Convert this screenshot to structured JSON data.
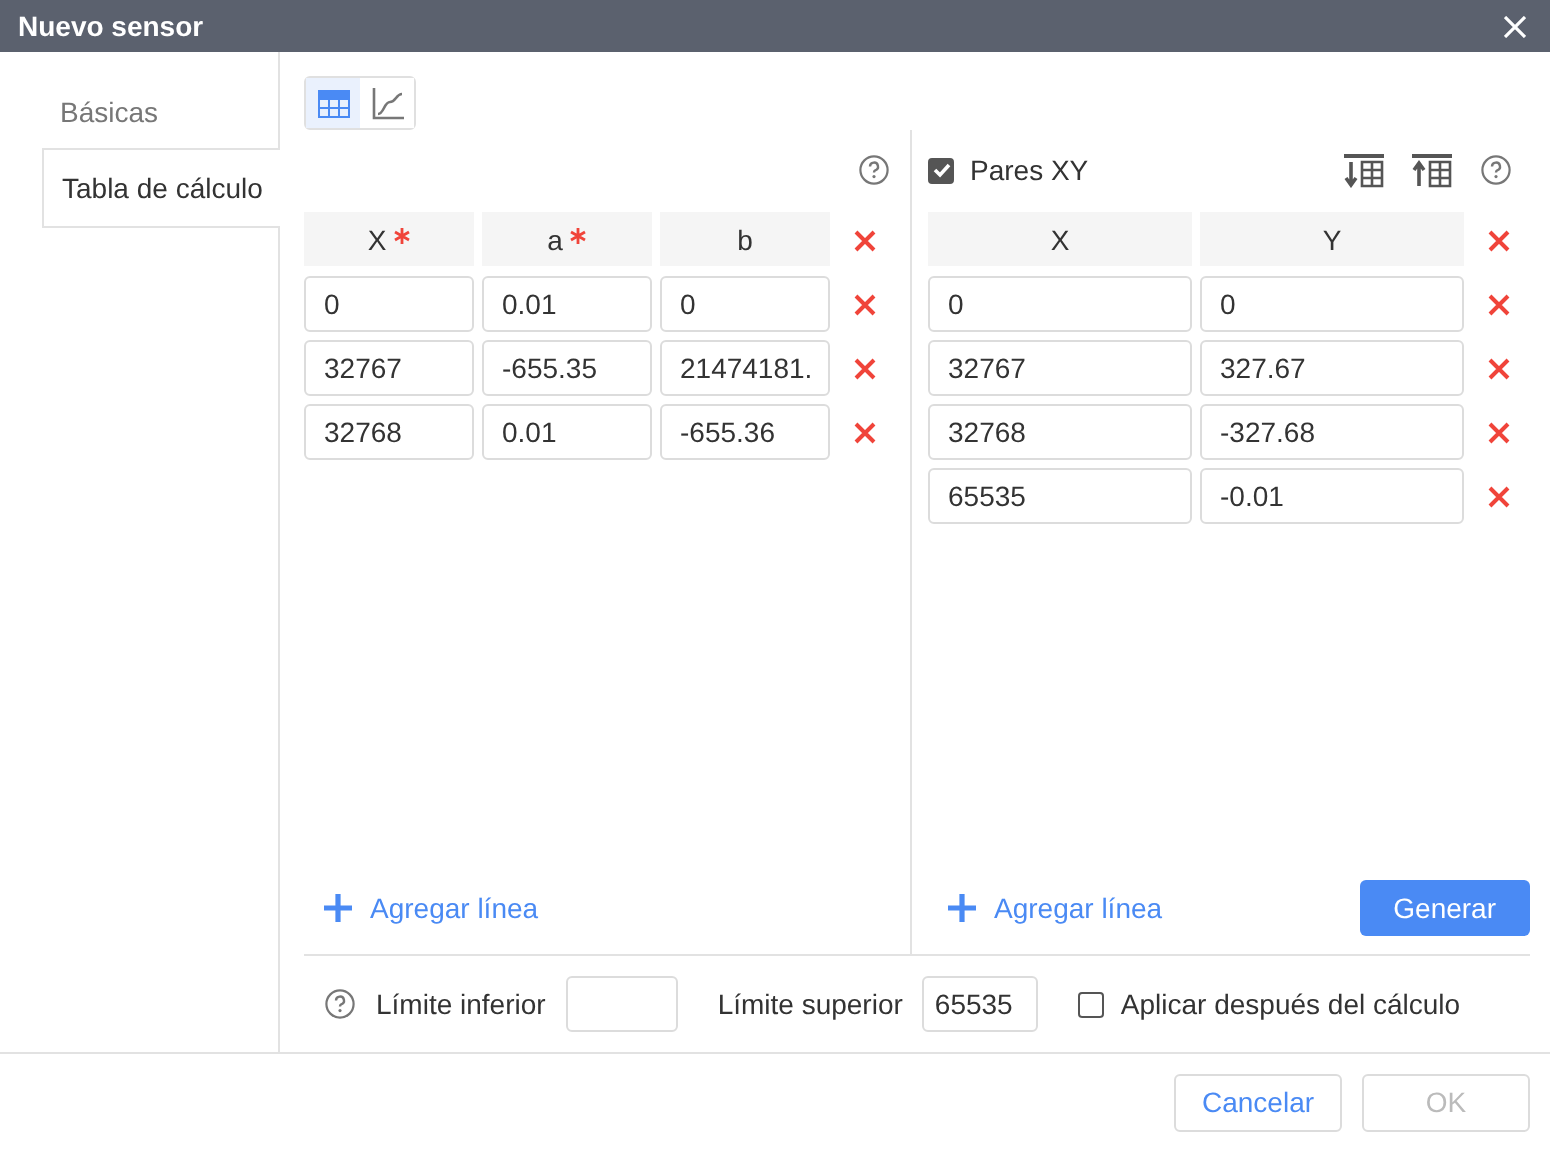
{
  "window": {
    "title": "Nuevo sensor"
  },
  "sidebar": {
    "tabs": [
      {
        "label": "Básicas",
        "selected": false
      },
      {
        "label": "Tabla de cálculo",
        "selected": true
      }
    ]
  },
  "view_toggle": [
    {
      "kind": "table",
      "selected": true
    },
    {
      "kind": "chart",
      "selected": false
    }
  ],
  "formula_table": {
    "columns": [
      {
        "label": "X",
        "required": true
      },
      {
        "label": "a",
        "required": true
      },
      {
        "label": "b",
        "required": false
      }
    ],
    "rows": [
      [
        "0",
        "0.01",
        "0"
      ],
      [
        "32767",
        "-655.35",
        "21474181."
      ],
      [
        "32768",
        "0.01",
        "-655.36"
      ]
    ],
    "add_label": "Agregar línea"
  },
  "xy_pairs": {
    "checked": true,
    "label": "Pares XY",
    "columns": [
      {
        "label": "X",
        "required": false
      },
      {
        "label": "Y",
        "required": false
      }
    ],
    "rows": [
      [
        "0",
        "0"
      ],
      [
        "32767",
        "327.67"
      ],
      [
        "32768",
        "-327.68"
      ],
      [
        "65535",
        "-0.01"
      ]
    ],
    "add_label": "Agregar línea",
    "generate_label": "Generar"
  },
  "limits": {
    "lower_label": "Límite inferior",
    "upper_label": "Límite superior",
    "upper_value": "65535",
    "apply_after": {
      "label": "Aplicar después del cálculo",
      "checked": false
    }
  },
  "footer": {
    "buttons": [
      {
        "label": "Cancelar",
        "disabled": false
      },
      {
        "label": "OK",
        "disabled": true
      }
    ]
  }
}
